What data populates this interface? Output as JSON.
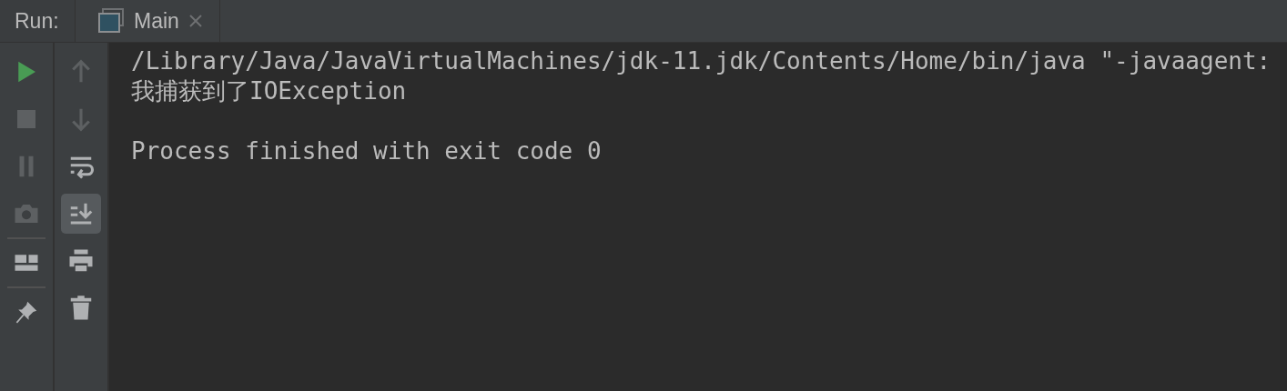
{
  "tool_window": {
    "title": "Run:"
  },
  "tabs": [
    {
      "label": "Main",
      "selected": true,
      "closable": true
    }
  ],
  "run_toolbar": [
    {
      "kind": "run",
      "disabled": false
    },
    {
      "kind": "stop",
      "disabled": true
    },
    {
      "kind": "pause",
      "disabled": true
    },
    {
      "kind": "camera",
      "disabled": true
    },
    {
      "kind": "separator"
    },
    {
      "kind": "layout",
      "disabled": false
    },
    {
      "kind": "separator"
    },
    {
      "kind": "pin",
      "disabled": false
    }
  ],
  "console_toolbar": [
    {
      "kind": "up",
      "disabled": true,
      "selected": false
    },
    {
      "kind": "down",
      "disabled": true,
      "selected": false
    },
    {
      "kind": "wrap",
      "disabled": false,
      "selected": false
    },
    {
      "kind": "scroll_end",
      "disabled": false,
      "selected": true
    },
    {
      "kind": "print",
      "disabled": false,
      "selected": false
    },
    {
      "kind": "trash",
      "disabled": false,
      "selected": false
    }
  ],
  "console": {
    "lines": [
      "/Library/Java/JavaVirtualMachines/jdk-11.jdk/Contents/Home/bin/java \"-javaagent:",
      "我捕获到了IOException"
    ],
    "exit_message": "Process finished with exit code 0"
  }
}
